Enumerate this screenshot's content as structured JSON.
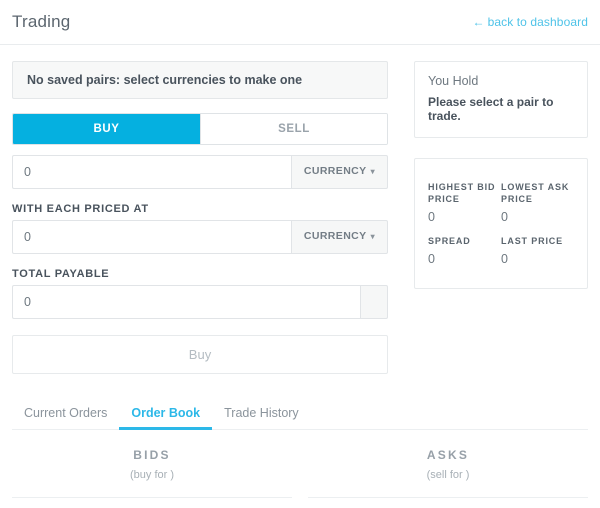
{
  "header": {
    "title": "Trading",
    "back_link": "back to dashboard",
    "back_arrow": "←"
  },
  "form": {
    "alert": "No saved pairs: select currencies to make one",
    "toggle": {
      "buy_label": "BUY",
      "sell_label": "SELL",
      "active": "BUY"
    },
    "amount": {
      "value": "0",
      "placeholder": "0",
      "currency_label": "CURRENCY",
      "caret": "▾"
    },
    "price": {
      "label": "WITH EACH PRICED AT",
      "value": "0",
      "placeholder": "0",
      "currency_label": "CURRENCY",
      "caret": "▾"
    },
    "total": {
      "label": "TOTAL PAYABLE",
      "value": "0",
      "placeholder": "0",
      "addon_label": ""
    },
    "submit_label": "Buy"
  },
  "holdings": {
    "title": "You Hold",
    "message": "Please select a pair to trade."
  },
  "stats": [
    {
      "label": "HIGHEST BID PRICE",
      "value": "0"
    },
    {
      "label": "LOWEST ASK PRICE",
      "value": "0"
    },
    {
      "label": "SPREAD",
      "value": "0"
    },
    {
      "label": "LAST PRICE",
      "value": "0"
    }
  ],
  "tabs": [
    {
      "label": "Current Orders",
      "active": false
    },
    {
      "label": "Order Book",
      "active": true
    },
    {
      "label": "Trade History",
      "active": false
    }
  ],
  "book": {
    "bids": {
      "heading": "BIDS",
      "sub": "(buy for )"
    },
    "asks": {
      "heading": "ASKS",
      "sub": "(sell for )"
    }
  },
  "colors": {
    "accent": "#05b0e0",
    "tab_active": "#2cb8e8",
    "link": "#4fc3e8",
    "text": "#49535d",
    "muted": "#8b949c",
    "border": "#e7eaec"
  }
}
